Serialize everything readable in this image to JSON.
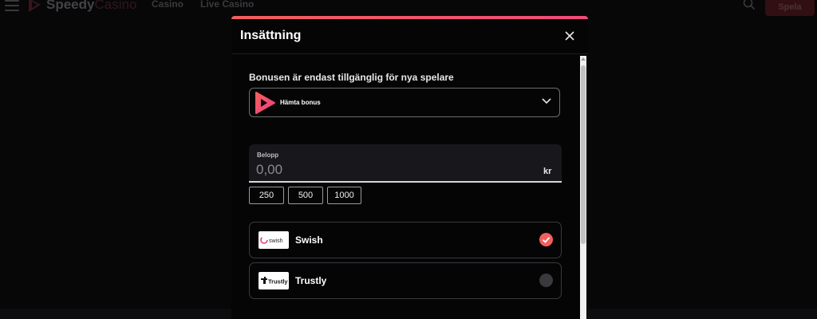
{
  "header": {
    "logo_primary": "Speedy",
    "logo_secondary": "Casino",
    "nav": [
      "Casino",
      "Live Casino"
    ],
    "cta_label": "Spela"
  },
  "modal": {
    "title": "Insättning",
    "bonus": {
      "label": "Bonusen är endast tillgänglig för nya spelare",
      "selected": "Hämta bonus"
    },
    "amount": {
      "label": "Belopp",
      "placeholder": "0,00",
      "currency": "kr",
      "quick_amounts": [
        "250",
        "500",
        "1000"
      ]
    },
    "payment_methods": [
      {
        "name": "Swish",
        "logo_text": "swish",
        "selected": true
      },
      {
        "name": "Trustly",
        "logo_text": "Trustly",
        "selected": false
      }
    ]
  },
  "colors": {
    "accent": "#f25f5c",
    "accent_pink": "#ef4b7a",
    "modal_bg": "#050505",
    "page_bg": "#0d0d0f"
  }
}
